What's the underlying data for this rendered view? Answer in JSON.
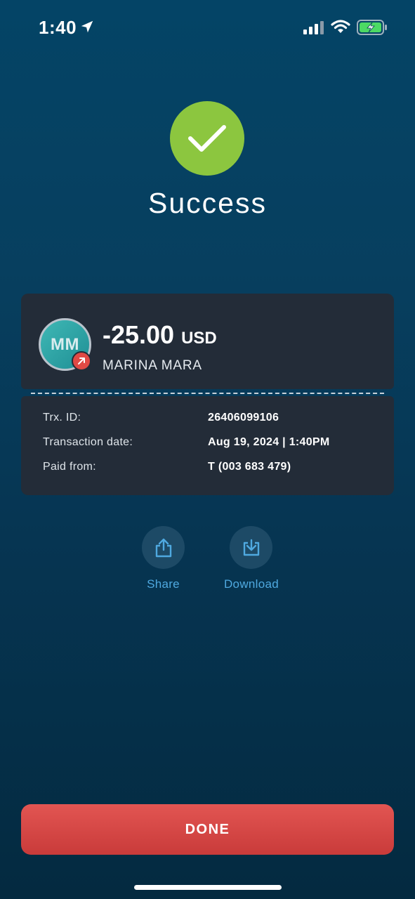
{
  "status_bar": {
    "time": "1:40",
    "icons": [
      "location-arrow-icon",
      "cellular-signal-icon",
      "wifi-icon",
      "battery-charging-icon"
    ]
  },
  "header": {
    "icon": "checkmark-icon",
    "title": "Success"
  },
  "transaction": {
    "avatar_initials": "MM",
    "direction_icon": "arrow-up-right-icon",
    "amount": "-25.00",
    "currency": "USD",
    "recipient": "MARINA MARA",
    "details": [
      {
        "label": "Trx. ID:",
        "value": "26406099106"
      },
      {
        "label": "Transaction date:",
        "value": "Aug 19, 2024 | 1:40PM"
      },
      {
        "label": "Paid from:",
        "value": "T (003 683 479)"
      }
    ]
  },
  "actions": {
    "share_label": "Share",
    "download_label": "Download"
  },
  "done_label": "DONE",
  "colors": {
    "success": "#8cc63f",
    "accent_link": "#4fa9e0",
    "done_button": "#d94a48",
    "card": "#232c38"
  }
}
